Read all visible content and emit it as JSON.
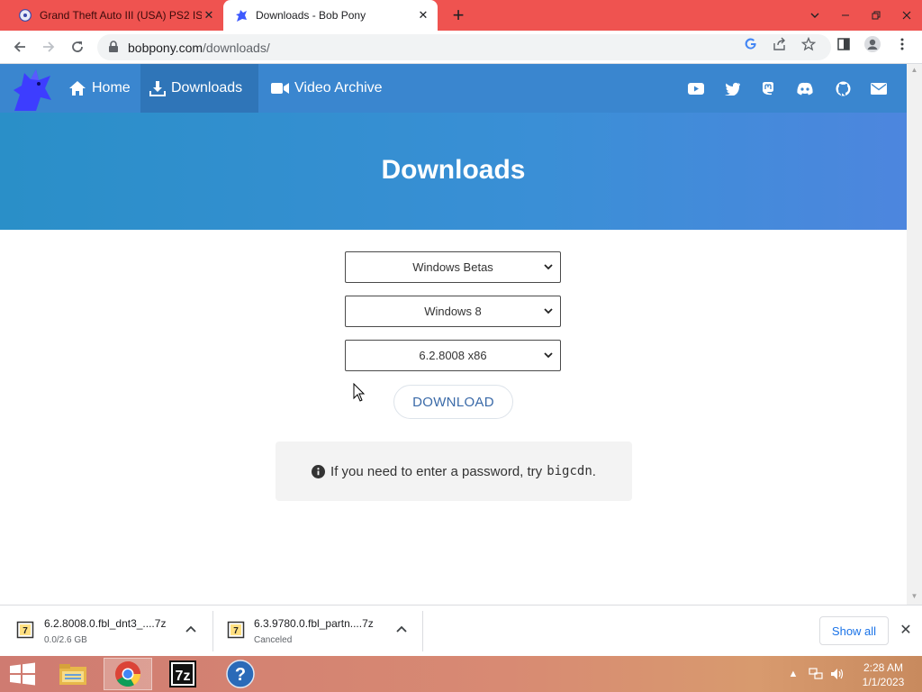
{
  "browser": {
    "tabs": [
      {
        "title": "Grand Theft Auto III (USA) PS2 IS",
        "active": false
      },
      {
        "title": "Downloads - Bob Pony",
        "active": true
      }
    ],
    "new_tab_icon": "plus-icon",
    "address": {
      "host": "bobpony.com",
      "path": "/downloads/"
    }
  },
  "site": {
    "nav": [
      {
        "label": "Home",
        "icon": "home-icon"
      },
      {
        "label": "Downloads",
        "icon": "download-icon",
        "selected": true
      },
      {
        "label": "Video Archive",
        "icon": "video-camera-icon"
      }
    ],
    "social": [
      "youtube-icon",
      "twitter-icon",
      "mastodon-icon",
      "discord-icon",
      "github-icon",
      "mail-icon"
    ],
    "hero_title": "Downloads"
  },
  "form": {
    "category": "Windows Betas",
    "product": "Windows 8",
    "build": "6.2.8008 x86",
    "download_label": "DOWNLOAD",
    "info_text": "If you need to enter a password, try",
    "info_code": "bigcdn",
    "info_suffix": "."
  },
  "downloads_shelf": {
    "items": [
      {
        "name": "6.2.8008.0.fbl_dnt3_....7z",
        "status": "0.0/2.6 GB"
      },
      {
        "name": "6.3.9780.0.fbl_partn....7z",
        "status": "Canceled"
      }
    ],
    "show_all_label": "Show all"
  },
  "taskbar": {
    "apps": [
      "file-explorer-icon",
      "chrome-icon",
      "7zip-icon",
      "help-icon"
    ],
    "time": "2:28 AM",
    "date": "1/1/2023"
  },
  "colors": {
    "tab_strip": "#ef5350",
    "site_nav": "#3a86cf",
    "hero_start": "#2a8fc8",
    "hero_end": "#4d86de",
    "link_blue": "#1a73e8"
  }
}
